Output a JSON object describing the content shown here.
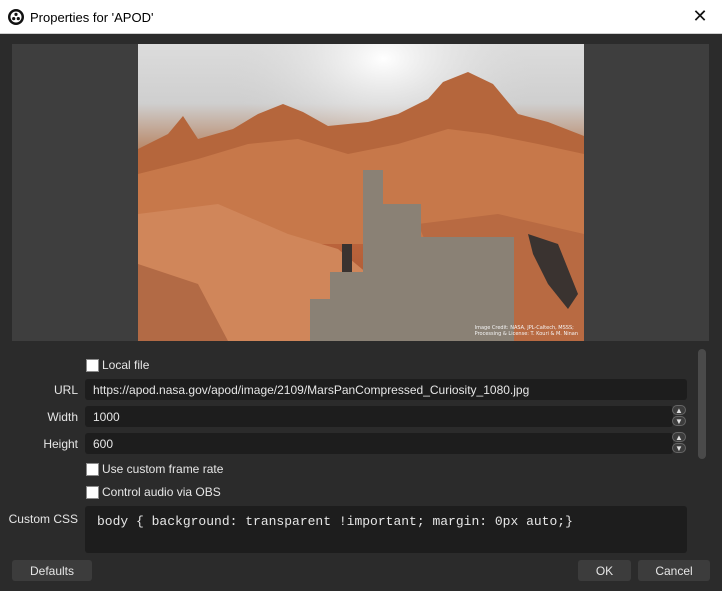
{
  "window": {
    "title": "Properties for 'APOD'",
    "close_symbol": "✕"
  },
  "preview": {
    "credit_lines": [
      "Image Credit: NASA, JPL-Caltech, MSSS;",
      "Processing & License: T. Kouri & M. Ninan"
    ]
  },
  "fields": {
    "local_file_label": "Local file",
    "url_label": "URL",
    "url_value": "https://apod.nasa.gov/apod/image/2109/MarsPanCompressed_Curiosity_1080.jpg",
    "width_label": "Width",
    "width_value": "1000",
    "height_label": "Height",
    "height_value": "600",
    "custom_frame_rate_label": "Use custom frame rate",
    "control_audio_label": "Control audio via OBS",
    "custom_css_label": "Custom CSS",
    "custom_css_value": "body { background: transparent !important; margin: 0px auto;}"
  },
  "buttons": {
    "defaults": "Defaults",
    "ok": "OK",
    "cancel": "Cancel"
  },
  "spin": {
    "up": "▲",
    "down": "▼"
  }
}
